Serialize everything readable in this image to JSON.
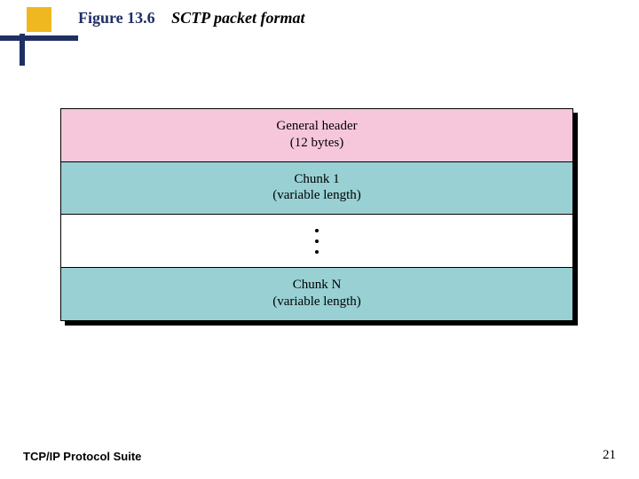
{
  "figure": {
    "number": "Figure 13.6",
    "caption": "SCTP packet format"
  },
  "packet": {
    "header_line1": "General header",
    "header_line2": "(12 bytes)",
    "chunk1_line1": "Chunk 1",
    "chunk1_line2": "(variable length)",
    "chunkN_line1": "Chunk N",
    "chunkN_line2": "(variable length)"
  },
  "footer": {
    "suite": "TCP/IP Protocol Suite",
    "page": "21"
  }
}
